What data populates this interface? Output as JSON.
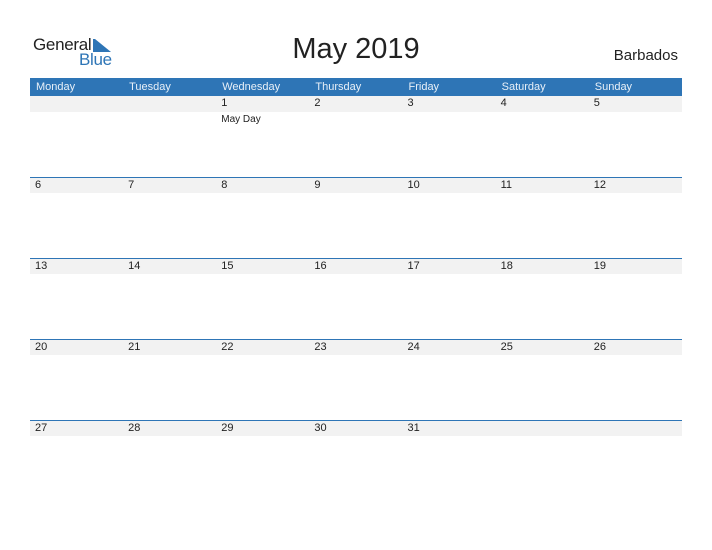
{
  "logo": {
    "line1": "General",
    "line2": "Blue"
  },
  "title": "May 2019",
  "country": "Barbados",
  "weekdays": [
    "Monday",
    "Tuesday",
    "Wednesday",
    "Thursday",
    "Friday",
    "Saturday",
    "Sunday"
  ],
  "weeks": [
    {
      "dates": [
        "",
        "",
        "1",
        "2",
        "3",
        "4",
        "5"
      ],
      "events": [
        "",
        "",
        "May Day",
        "",
        "",
        "",
        ""
      ]
    },
    {
      "dates": [
        "6",
        "7",
        "8",
        "9",
        "10",
        "11",
        "12"
      ],
      "events": [
        "",
        "",
        "",
        "",
        "",
        "",
        ""
      ]
    },
    {
      "dates": [
        "13",
        "14",
        "15",
        "16",
        "17",
        "18",
        "19"
      ],
      "events": [
        "",
        "",
        "",
        "",
        "",
        "",
        ""
      ]
    },
    {
      "dates": [
        "20",
        "21",
        "22",
        "23",
        "24",
        "25",
        "26"
      ],
      "events": [
        "",
        "",
        "",
        "",
        "",
        "",
        ""
      ]
    },
    {
      "dates": [
        "27",
        "28",
        "29",
        "30",
        "31",
        "",
        ""
      ],
      "events": [
        "",
        "",
        "",
        "",
        "",
        "",
        ""
      ]
    }
  ],
  "colors": {
    "accent": "#2e75b6",
    "date_row_bg": "#f2f2f2"
  }
}
